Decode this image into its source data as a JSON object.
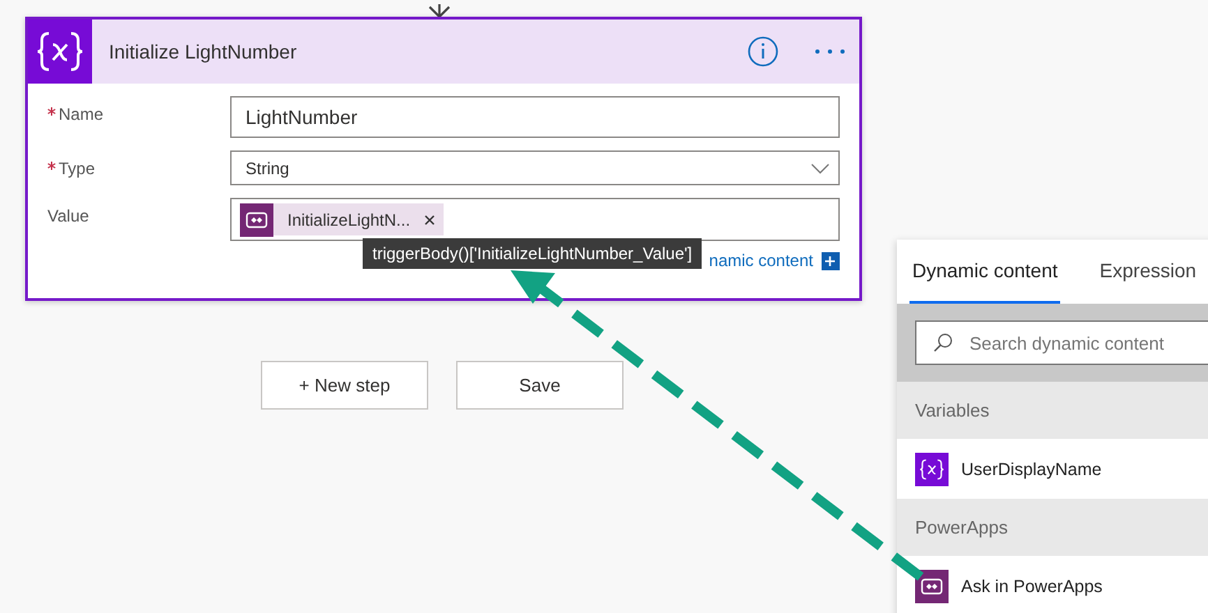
{
  "card": {
    "title": "Initialize LightNumber",
    "fields": [
      {
        "kind": "text",
        "label": "Name",
        "required": true,
        "value": "LightNumber"
      },
      {
        "kind": "dropdown",
        "label": "Type",
        "required": true,
        "value": "String"
      },
      {
        "kind": "tokens",
        "label": "Value",
        "required": false,
        "tokens": [
          "InitializeLightN..."
        ]
      }
    ],
    "add_dynamic_link": "namic content",
    "tooltip": "triggerBody()['InitializeLightNumber_Value']"
  },
  "buttons": [
    "+ New step",
    "Save"
  ],
  "panel": {
    "tabs": [
      {
        "label": "Dynamic content",
        "selected": true
      },
      {
        "label": "Expression",
        "selected": false
      }
    ],
    "search": {
      "placeholder": "Search dynamic content"
    },
    "sections": [
      {
        "title": "Variables",
        "items": [
          {
            "kind": "variable",
            "label": "UserDisplayName"
          }
        ]
      },
      {
        "title": "PowerApps",
        "items": [
          {
            "kind": "powerapps",
            "label": "Ask in PowerApps"
          }
        ]
      }
    ]
  }
}
